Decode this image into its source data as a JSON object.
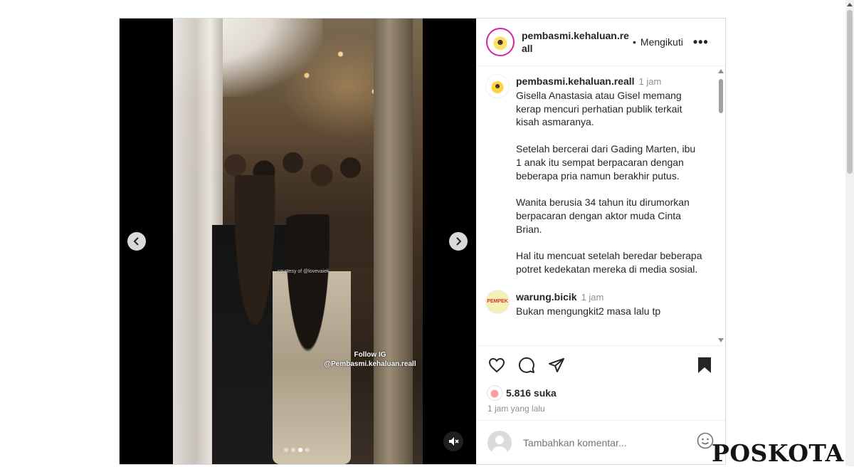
{
  "header": {
    "username": "pembasmi.kehaluan.reall",
    "separator": "•",
    "follow_label": "Mengikuti",
    "more_icon": "more-horizontal-icon"
  },
  "media": {
    "watermark_courtesy": "courtesy of @lovevaiek",
    "watermark_follow": "Follow IG",
    "watermark_handle": "@Pembasmi.kehaluan.reall",
    "slide_count": 4,
    "active_slide": 3
  },
  "caption": {
    "username": "pembasmi.kehaluan.reall",
    "time": "1 jam",
    "text": "Gisella Anastasia atau Gisel memang kerap mencuri perhatian publik terkait kisah asmaranya.\n\nSetelah bercerai dari Gading Marten, ibu 1 anak itu sempat berpacaran dengan beberapa pria namun berakhir putus.\n\nWanita berusia 34 tahun itu dirumorkan berpacaran dengan aktor muda Cinta Brian.\n\nHal itu mencuat setelah beredar beberapa potret kedekatan mereka di media sosial."
  },
  "comments": [
    {
      "username": "warung.bicik",
      "avatar_text": "PEMPEK",
      "time": "1 jam",
      "text": "Bukan mengungkit2 masa lalu tp"
    }
  ],
  "likes": {
    "count_label": "5.816 suka"
  },
  "post_time": "1 jam yang lalu",
  "add_comment": {
    "placeholder": "Tambahkan komentar..."
  },
  "logo": {
    "text": "POSKOTA"
  },
  "colors": {
    "text": "#262626",
    "muted": "#8e8e8e",
    "border": "#dbdbdb"
  }
}
